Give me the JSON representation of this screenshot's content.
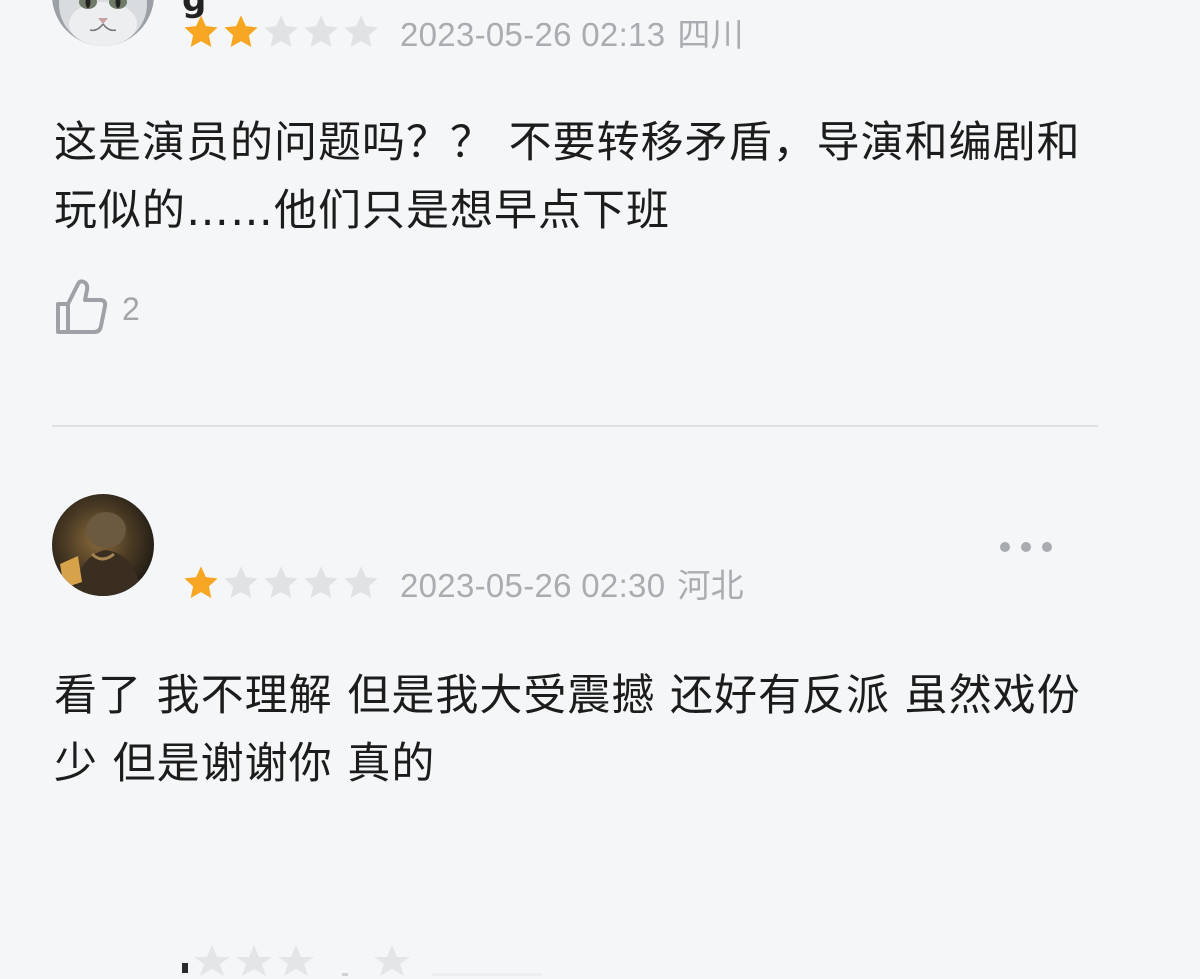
{
  "reviews": [
    {
      "username": "g",
      "rating": 2,
      "rating_max": 5,
      "date": "2023-05-26 02:13",
      "location": "四川",
      "content": "这是演员的问题吗？？ 不要转移矛盾，导演和编剧和玩似的……他们只是想早点下班",
      "likes": "2",
      "avatar_icon": "cat-avatar-icon"
    },
    {
      "username": "",
      "rating": 1,
      "rating_max": 5,
      "date": "2023-05-26 02:30",
      "location": "河北",
      "content": "看了 我不理解 但是我大受震撼 还好有反派 虽然戏份少 但是谢谢你 真的",
      "avatar_icon": "character-avatar-icon"
    }
  ],
  "icons": {
    "like": "thumbs-up-icon",
    "more": "more-dots-icon",
    "star": "star-icon"
  },
  "colors": {
    "star_filled": "#f6a623",
    "star_empty": "#e0e2e4",
    "meta_text": "#a9adb1",
    "background": "#f4f6f7"
  }
}
